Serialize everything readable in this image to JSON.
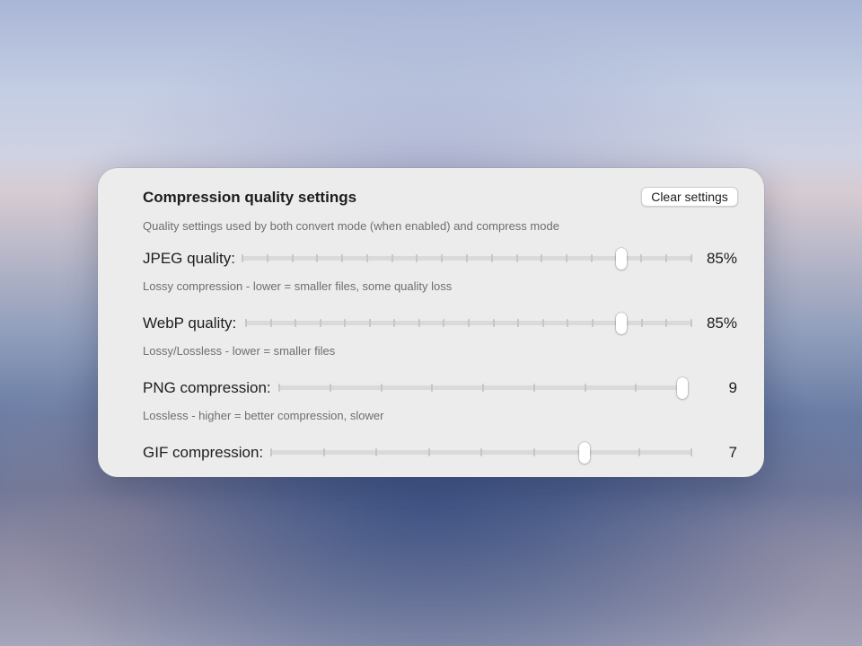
{
  "panel": {
    "title": "Compression quality settings",
    "clear_button": "Clear settings",
    "description": "Quality settings used by both convert mode (when enabled) and compress mode"
  },
  "settings": [
    {
      "label": "JPEG quality:",
      "value_text": "85%",
      "value": 85,
      "min": 0,
      "max": 100,
      "tick_count": 19,
      "hint": "Lossy compression - lower = smaller files, some quality loss"
    },
    {
      "label": "WebP quality:",
      "value_text": "85%",
      "value": 85,
      "min": 0,
      "max": 100,
      "tick_count": 19,
      "hint": "Lossy/Lossless - lower = smaller files"
    },
    {
      "label": "PNG compression:",
      "value_text": "9",
      "value": 9,
      "min": 1,
      "max": 9,
      "tick_count": 9,
      "hint": "Lossless - higher = better compression, slower"
    },
    {
      "label": "GIF compression:",
      "value_text": "7",
      "value": 7,
      "min": 1,
      "max": 9,
      "tick_count": 9,
      "hint": ""
    }
  ]
}
